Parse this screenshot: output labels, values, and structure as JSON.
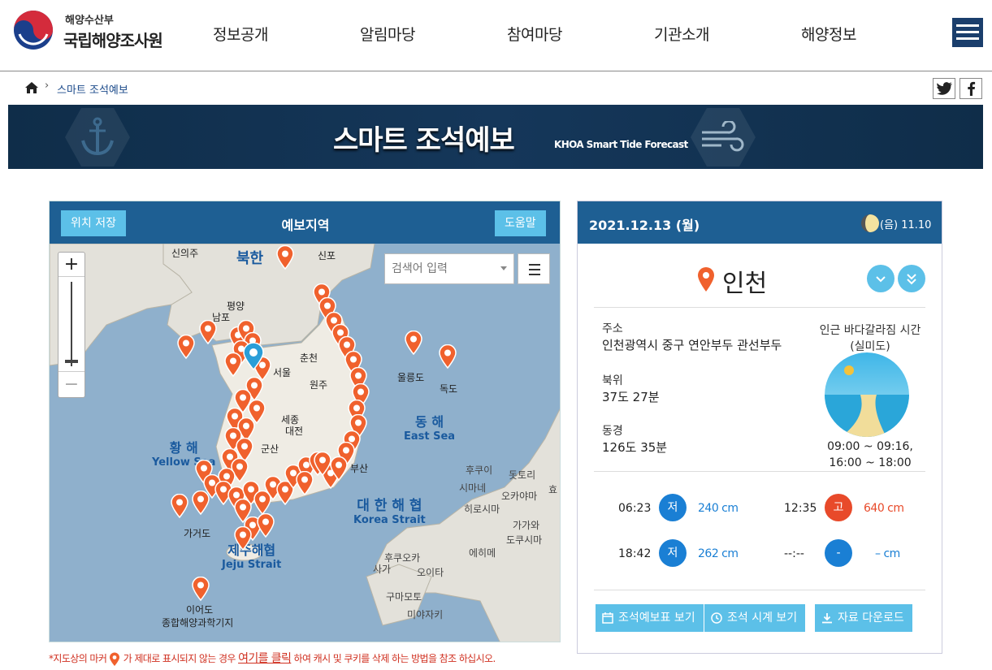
{
  "header": {
    "org_top": "해양수산부",
    "org_name": "국립해양조사원",
    "nav": [
      "정보공개",
      "알림마당",
      "참여마당",
      "기관소개",
      "해양정보"
    ]
  },
  "breadcrumb": {
    "current": "스마트 조석예보"
  },
  "banner": {
    "title": "스마트 조석예보",
    "subtitle": "KHOA Smart Tide Forecast"
  },
  "map": {
    "save_label": "위치 저장",
    "title": "예보지역",
    "help_label": "도움말",
    "search_placeholder": "검색어 입력",
    "zoom_in": "+",
    "zoom_out": "−",
    "labels": {
      "sinuiju": "신의주",
      "sinpo": "신포",
      "pyongyang": "평양",
      "nampo": "남포",
      "chuncheon": "춘천",
      "seoul": "서울",
      "wonju": "원주",
      "sejong": "세종",
      "daejeon": "대전",
      "gunsan": "군산",
      "busan": "부산",
      "ulleungdo": "울릉도",
      "dokdo": "독도",
      "gageodo": "가거도",
      "ieodo": "이어도",
      "ieodo_station": "종합해양과학기지",
      "bukhan": "북한",
      "hukui": "후쿠이",
      "totori": "돗토리",
      "shimane": "시마네",
      "okayama": "오카야마",
      "hiroshima": "히로시마",
      "kagawa": "가가와",
      "tokushima": "도쿠시마",
      "ehime": "에히메",
      "fukuoka": "후쿠오카",
      "saga": "사가",
      "oita": "오이타",
      "kumamoto": "구마모토",
      "miyazaki": "미야자키",
      "hyogo": "효"
    },
    "seas": {
      "yellow_ko": "황 해",
      "yellow_en": "Yellow Sea",
      "east_ko": "동 해",
      "east_en": "East Sea",
      "korea_strait_ko": "대 한 해 협",
      "korea_strait_en": "Korea Strait",
      "jeju_strait_ko": "제주해협",
      "jeju_strait_en": "Jeju Strait"
    }
  },
  "note": {
    "pre": "*지도상의 마커",
    "mid": "가 제대로 표시되지 않는 경우",
    "link": "여기를 클릭",
    "post": "하여 캐시 및 쿠키를 삭제 하는 방법을 참조 하십시오."
  },
  "info": {
    "date": "2021.12.13 (월)",
    "lunar": "(음) 11.10",
    "location": "인천",
    "address_label": "주소",
    "address": "인천광역시 중구 연안부두 관선부두",
    "lat_label": "북위",
    "lat": "37도 27분",
    "lon_label": "동경",
    "lon": "126도 35분",
    "near_title": "인근 바다갈라짐 시간",
    "near_place": "(실미도)",
    "near_time_1": "09:00 ~ 09:16,",
    "near_time_2": "16:00 ~ 18:00",
    "tides": [
      {
        "time": "06:23",
        "type": "저",
        "value": "240 cm"
      },
      {
        "time": "12:35",
        "type": "고",
        "value": "640 cm"
      },
      {
        "time": "18:42",
        "type": "저",
        "value": "262 cm"
      },
      {
        "time": "--:--",
        "type": "-",
        "value": "– cm"
      }
    ],
    "buttons": [
      "조석예보표 보기",
      "조석 시계 보기",
      "자료 다운로드"
    ]
  },
  "colors": {
    "primary": "#1e5f93",
    "accent": "#5cc0e8",
    "low": "#1a7fd4",
    "high": "#e84a2a",
    "warn": "#d03020"
  }
}
